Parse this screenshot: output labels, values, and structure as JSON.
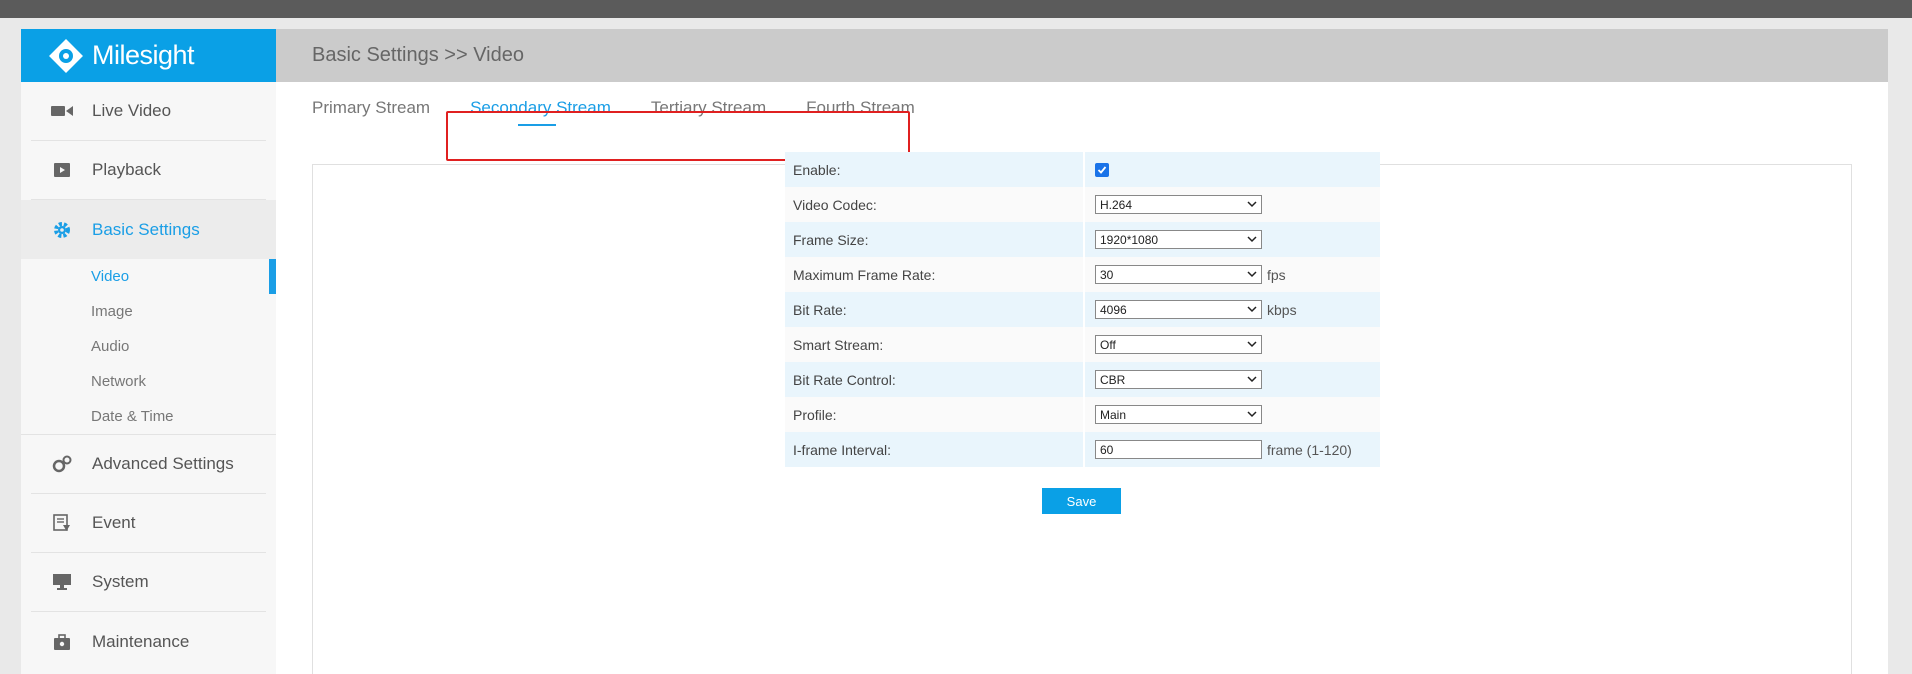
{
  "brand": {
    "name": "Milesight",
    "accent": "#0aa0e6"
  },
  "sidebar": {
    "items": [
      {
        "label": "Live Video",
        "icon": "video-camera-icon"
      },
      {
        "label": "Playback",
        "icon": "play-icon"
      },
      {
        "label": "Basic Settings",
        "icon": "gear-icon"
      },
      {
        "label": "Advanced Settings",
        "icon": "gears-icon"
      },
      {
        "label": "Event",
        "icon": "event-icon"
      },
      {
        "label": "System",
        "icon": "monitor-icon"
      },
      {
        "label": "Maintenance",
        "icon": "toolbox-icon"
      }
    ],
    "sub_items": [
      "Video",
      "Image",
      "Audio",
      "Network",
      "Date & Time"
    ]
  },
  "header": {
    "breadcrumb": "Basic Settings >> Video"
  },
  "tabs": [
    "Primary Stream",
    "Secondary Stream",
    "Tertiary Stream",
    "Fourth Stream"
  ],
  "form": {
    "enable_label": "Enable:",
    "enable_checked": true,
    "codec_label": "Video Codec:",
    "codec_value": "H.264",
    "frame_size_label": "Frame Size:",
    "frame_size_value": "1920*1080",
    "max_rate_label": "Maximum Frame Rate:",
    "max_rate_value": "30",
    "max_rate_unit": "fps",
    "bit_rate_label": "Bit Rate:",
    "bit_rate_value": "4096",
    "bit_rate_unit": "kbps",
    "smart_label": "Smart Stream:",
    "smart_value": "Off",
    "control_label": "Bit Rate Control:",
    "control_value": "CBR",
    "profile_label": "Profile:",
    "profile_value": "Main",
    "iframe_label": "I-frame Interval:",
    "iframe_value": "60",
    "iframe_unit": "frame (1-120)"
  },
  "save_label": "Save"
}
